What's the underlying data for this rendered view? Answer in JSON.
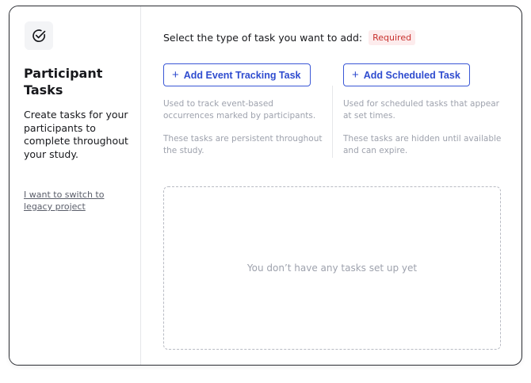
{
  "sidebar": {
    "icon": "check-circle-icon",
    "title": "Participant Tasks",
    "description": "Create tasks for your participants to complete throughout your study.",
    "legacy_link": "I want to switch to legacy project"
  },
  "main": {
    "prompt": "Select the type of task you want to add:",
    "required_badge": "Required",
    "event_task": {
      "button_label": "Add Event Tracking Task",
      "help_1": "Used to track event-based occurrences marked by participants.",
      "help_2": "These tasks are persistent throughout the study."
    },
    "scheduled_task": {
      "button_label": "Add Scheduled Task",
      "help_1": "Used for scheduled tasks that appear at set times.",
      "help_2": "These tasks are hidden until available and can expire."
    },
    "empty_state": "You don’t have any tasks set up yet"
  },
  "colors": {
    "accent": "#2f4ccf",
    "required_text": "#c8322e",
    "required_bg": "#fdeced",
    "muted_text": "#9ea2ad"
  }
}
